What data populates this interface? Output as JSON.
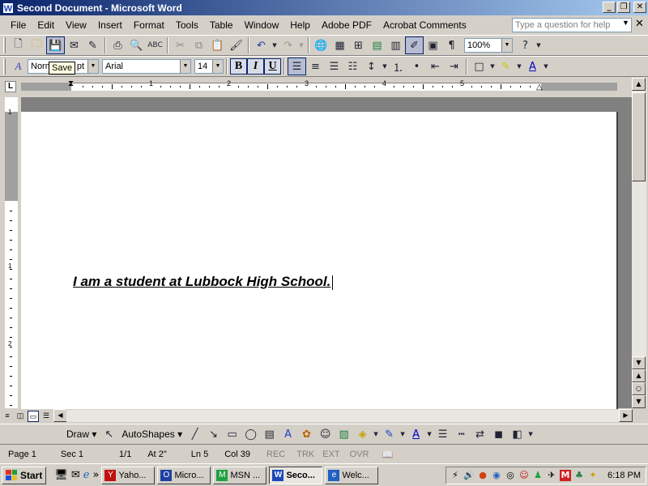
{
  "window": {
    "title": "Second Document - Microsoft Word",
    "app_icon": "W"
  },
  "menu": [
    "File",
    "Edit",
    "View",
    "Insert",
    "Format",
    "Tools",
    "Table",
    "Window",
    "Help",
    "Adobe PDF",
    "Acrobat Comments"
  ],
  "ask_box": {
    "placeholder": "Type a question for help"
  },
  "standard_toolbar": {
    "zoom": "100%",
    "tooltip": "Save"
  },
  "formatting_toolbar": {
    "style": "Norm",
    "style_suffix": "pt",
    "font": "Arial",
    "size": "14",
    "bold": "B",
    "italic": "I",
    "underline": "U"
  },
  "ruler": {
    "numbers": [
      "1",
      "2",
      "3",
      "4",
      "5"
    ],
    "tab_selector": "L"
  },
  "vruler": {
    "numbers": [
      "1",
      "1",
      "2"
    ]
  },
  "document": {
    "text": "I am a student at Lubbock High School."
  },
  "drawing_toolbar": {
    "draw": "Draw",
    "autoshapes": "AutoShapes"
  },
  "status": {
    "page": "Page 1",
    "sec": "Sec 1",
    "pages": "1/1",
    "at": "At 2\"",
    "ln": "Ln 5",
    "col": "Col 39",
    "rec": "REC",
    "trk": "TRK",
    "ext": "EXT",
    "ovr": "OVR"
  },
  "taskbar": {
    "start": "Start",
    "tasks": [
      {
        "label": "Yaho...",
        "icon_color": "#c01010",
        "icon": "Y"
      },
      {
        "label": "Micro...",
        "icon_color": "#2040a0",
        "icon": "O"
      },
      {
        "label": "MSN ...",
        "icon_color": "#20a040",
        "icon": "M"
      },
      {
        "label": "Seco...",
        "icon_color": "#1c48b8",
        "icon": "W"
      },
      {
        "label": "Welc...",
        "icon_color": "#2060c0",
        "icon": "e"
      }
    ],
    "clock": "6:18 PM"
  }
}
